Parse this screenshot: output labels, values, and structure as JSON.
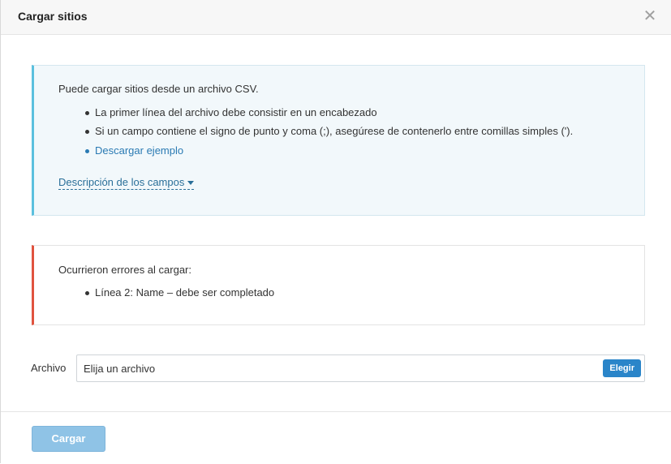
{
  "dialog": {
    "title": "Cargar sitios",
    "close_glyph": "✕",
    "close_icon": "close-icon"
  },
  "info": {
    "intro": "Puede cargar sitios desde un archivo CSV.",
    "items": [
      "La primer línea del archivo debe consistir en un encabezado",
      "Si un campo contiene el signo de punto y coma (;), asegúrese de contenerlo entre comillas simples (')."
    ],
    "download_link": "Descargar ejemplo",
    "fields_toggle": "Descripción de los campos",
    "fields_toggle_icon": "caret-down-icon"
  },
  "errors": {
    "heading": "Ocurrieron errores al cargar:",
    "items": [
      "Línea 2: Name – debe ser completado"
    ]
  },
  "file": {
    "label": "Archivo",
    "placeholder": "Elija un archivo",
    "choose_button": "Elegir"
  },
  "footer": {
    "submit_button": "Cargar"
  },
  "colors": {
    "info_accent": "#5bc0de",
    "error_accent": "#e0533f",
    "primary_button": "#2a85c9",
    "disabled_button": "#8fc3e6",
    "link": "#2a7ab3"
  }
}
